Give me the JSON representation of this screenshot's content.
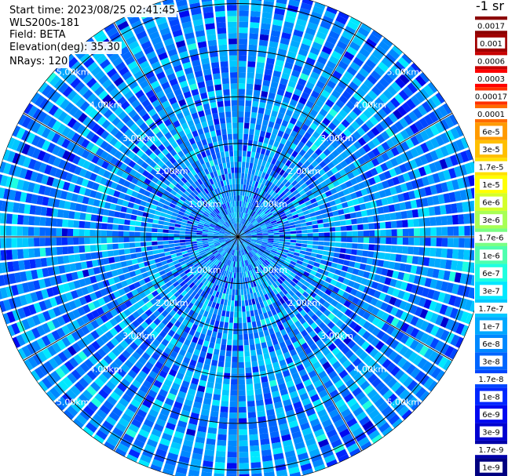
{
  "header": {
    "start_time": "Start time: 2023/08/25 02:41:45",
    "instrument": "WLS200s-181",
    "field": "Field: BETA",
    "elevation": "Elevation(deg): 35.30",
    "nrays": "NRays: 120"
  },
  "colorbar": {
    "unit_title": "-1 sr",
    "labels": [
      "0.0017",
      "0.001",
      "0.0006",
      "0.0003",
      "0.00017",
      "0.0001",
      "6e-5",
      "3e-5",
      "1.7e-5",
      "1e-5",
      "6e-6",
      "3e-6",
      "1.7e-6",
      "1e-6",
      "6e-7",
      "3e-7",
      "1.7e-7",
      "1e-7",
      "6e-8",
      "3e-8",
      "1.7e-8",
      "1e-8",
      "6e-9",
      "3e-9",
      "1.7e-9",
      "1e-9"
    ],
    "colors": [
      "#8b0000",
      "#a00000",
      "#c80000",
      "#ff0000",
      "#ff3000",
      "#ff6a00",
      "#ff9a00",
      "#ffbf00",
      "#ffe000",
      "#ffff00",
      "#d4ff2a",
      "#a8ff55",
      "#78ff84",
      "#4effae",
      "#1effe0",
      "#00e8ff",
      "#00c8ff",
      "#00a8ff",
      "#0088ff",
      "#0066ff",
      "#0046ff",
      "#0026ff",
      "#0008f0",
      "#0000d0",
      "#0000a8",
      "#000080"
    ]
  },
  "chart_data": {
    "type": "heatmap",
    "subtype": "polar PPI scan",
    "field": "BETA",
    "elevation_deg": 35.3,
    "n_rays": 120,
    "range_rings_km": [
      1,
      2,
      3,
      4,
      5
    ],
    "ring_labels": [
      "1.00km",
      "2.00km",
      "3.00km",
      "4.00km",
      "5.00km"
    ],
    "max_range_km": 5.3,
    "colorscale": "log, 1e-9 to 0.0017",
    "dominant_values": "mostly 1e-8 to 6e-7 (blue to cyan)"
  }
}
